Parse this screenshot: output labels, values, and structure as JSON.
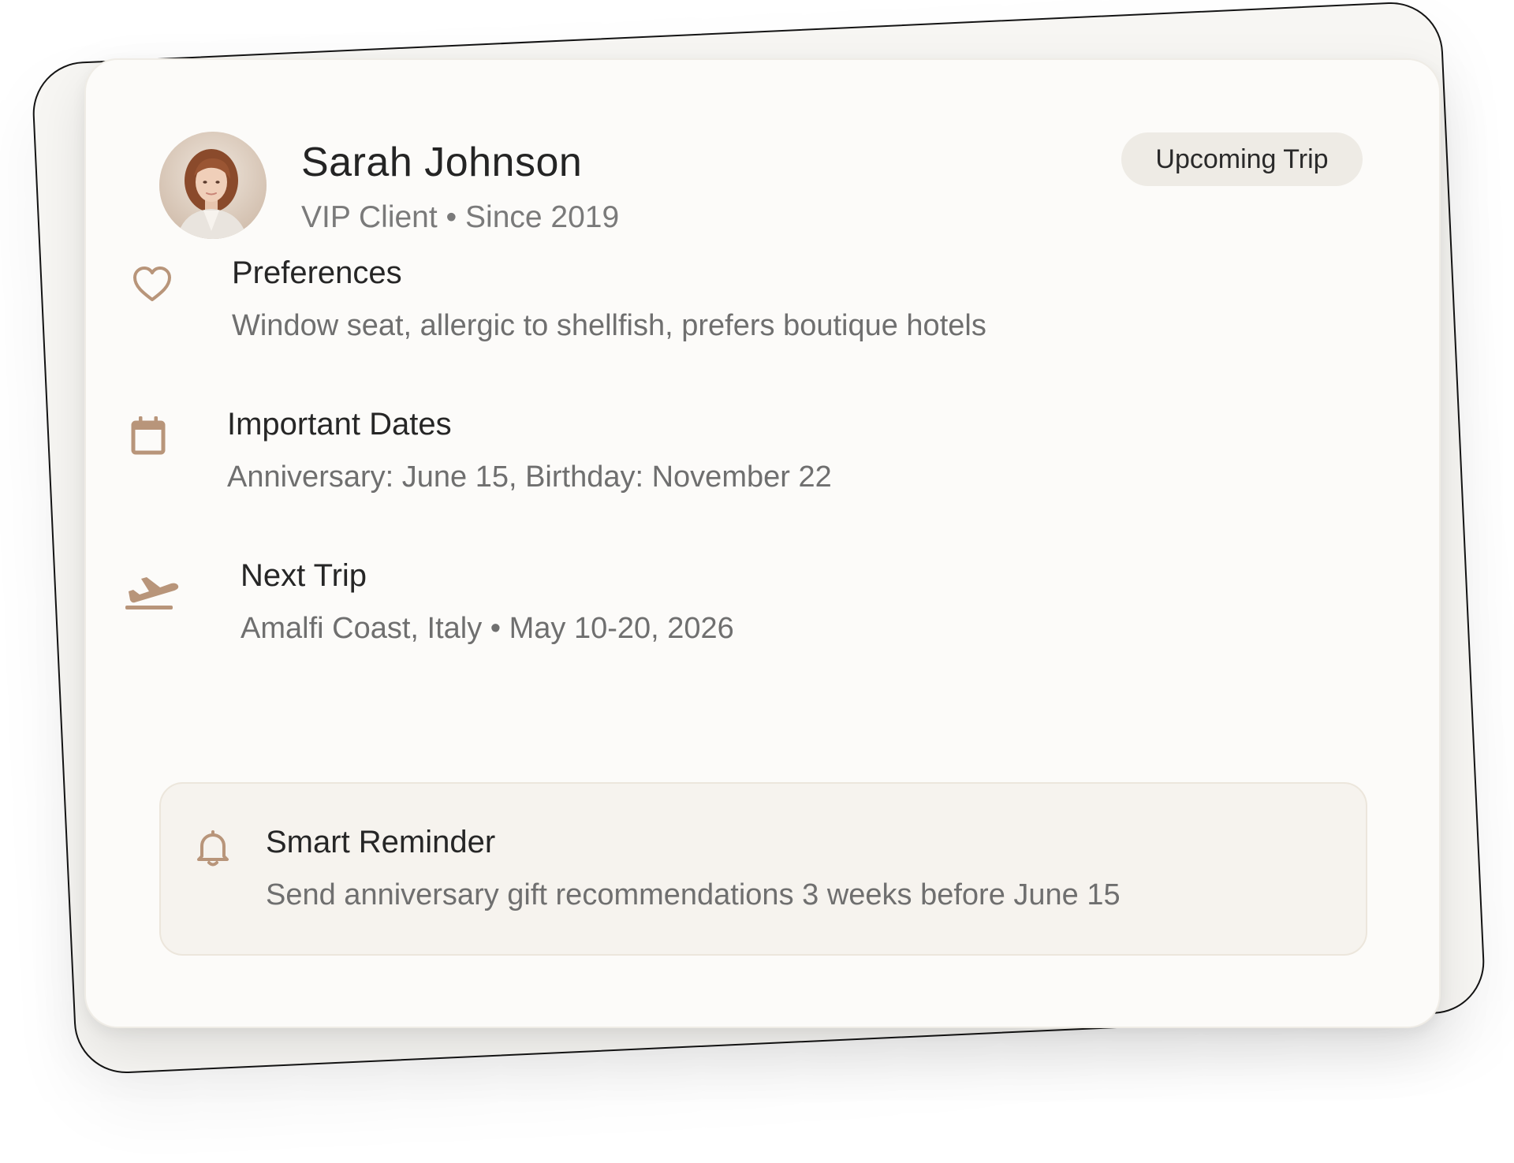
{
  "client": {
    "name": "Sarah Johnson",
    "subtitle": "VIP Client • Since 2019",
    "badge": "Upcoming Trip"
  },
  "sections": {
    "preferences": {
      "icon": "heart-icon",
      "title": "Preferences",
      "text": "Window seat, allergic to shellfish, prefers boutique hotels"
    },
    "dates": {
      "icon": "calendar-icon",
      "title": "Important Dates",
      "text": "Anniversary: June 15, Birthday: November 22"
    },
    "trip": {
      "icon": "airplane-takeoff-icon",
      "title": "Next Trip",
      "text": "Amalfi Coast, Italy • May 10-20, 2026"
    }
  },
  "reminder": {
    "icon": "bell-icon",
    "title": "Smart Reminder",
    "text": "Send anniversary gift recommendations 3 weeks before June 15"
  },
  "colors": {
    "accent": "#b8957a",
    "card_bg": "#fcfbf9",
    "badge_bg": "#eeebe5",
    "reminder_bg": "#f6f3ee",
    "title_text": "#242424",
    "muted_text": "#7a7a7a"
  }
}
